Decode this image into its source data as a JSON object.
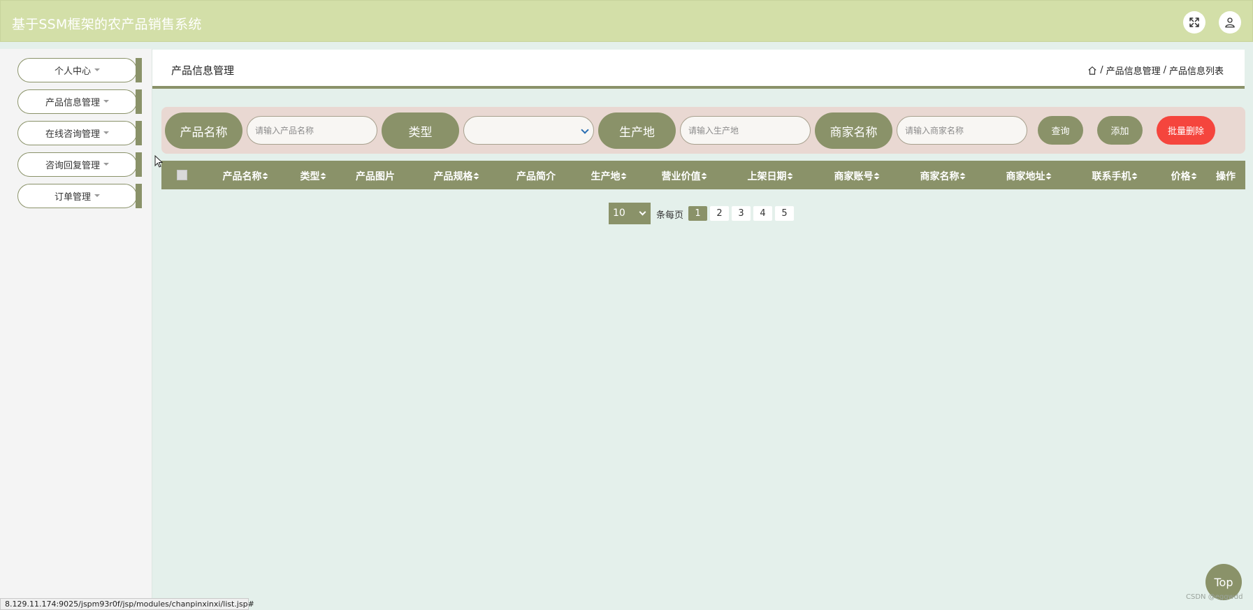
{
  "header": {
    "title": "基于SSM框架的农产品销售系统",
    "fullscreen_icon": "fullscreen-icon",
    "user_icon": "user-icon"
  },
  "sidebar": {
    "items": [
      {
        "label": "个人中心"
      },
      {
        "label": "产品信息管理"
      },
      {
        "label": "在线咨询管理"
      },
      {
        "label": "咨询回复管理"
      },
      {
        "label": "订单管理"
      }
    ]
  },
  "panel": {
    "title": "产品信息管理",
    "breadcrumb": {
      "home_icon": "home-icon",
      "separator": "/",
      "level1": "产品信息管理",
      "level2": "产品信息列表"
    }
  },
  "search": {
    "product_name_label": "产品名称",
    "product_name_placeholder": "请输入产品名称",
    "type_label": "类型",
    "type_value": "",
    "origin_label": "生产地",
    "origin_placeholder": "请输入生产地",
    "merchant_name_label": "商家名称",
    "merchant_name_placeholder": "请输入商家名称",
    "query_button": "查询",
    "add_button": "添加",
    "batch_delete_button": "批量删除"
  },
  "table": {
    "columns": [
      {
        "label": "产品名称",
        "sortable": true
      },
      {
        "label": "类型",
        "sortable": true
      },
      {
        "label": "产品图片",
        "sortable": false
      },
      {
        "label": "产品规格",
        "sortable": true
      },
      {
        "label": "产品简介",
        "sortable": false
      },
      {
        "label": "生产地",
        "sortable": true
      },
      {
        "label": "营业价值",
        "sortable": true
      },
      {
        "label": "上架日期",
        "sortable": true
      },
      {
        "label": "商家账号",
        "sortable": true
      },
      {
        "label": "商家名称",
        "sortable": true
      },
      {
        "label": "商家地址",
        "sortable": true
      },
      {
        "label": "联系手机",
        "sortable": true
      },
      {
        "label": "价格",
        "sortable": true
      },
      {
        "label": "操作",
        "sortable": false
      }
    ],
    "rows": []
  },
  "pagination": {
    "page_size": "10",
    "per_page_label": "条每页",
    "pages": [
      "1",
      "2",
      "3",
      "4",
      "5"
    ],
    "current_page": "1"
  },
  "top_button": "Top",
  "watermark": "CSDN @eggwdd",
  "status_url": "8.129.11.174:9025/jspm93r0f/jsp/modules/chanpinxinxi/list.jsp#",
  "colors": {
    "header_bg": "#d3dfa8",
    "accent": "#8a9269",
    "search_bg": "#e9d8d2",
    "danger": "#f5453d",
    "content_bg": "#e4f0eb"
  }
}
